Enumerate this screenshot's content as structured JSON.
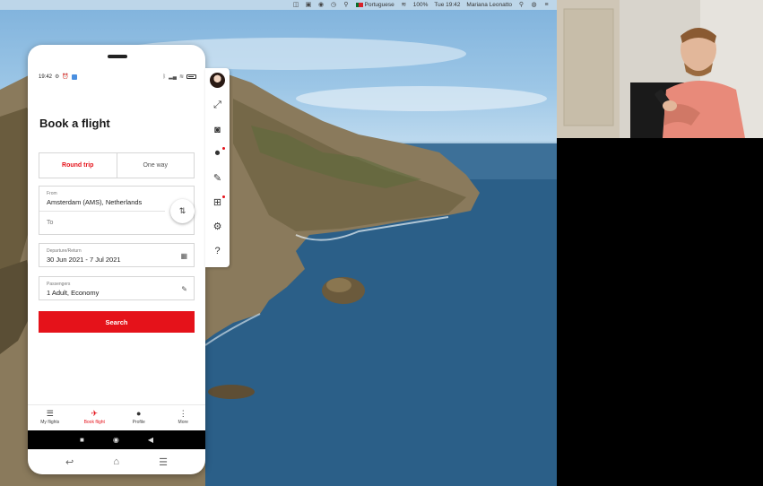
{
  "menubar": {
    "language": "Portuguese",
    "battery": "100%",
    "clock": "Tue 19:42",
    "user": "Mariana Leonatto"
  },
  "phone": {
    "status": {
      "time": "19:42"
    },
    "title": "Book a flight",
    "trip_type": {
      "options": [
        "Round trip",
        "One way"
      ],
      "selected": "Round trip"
    },
    "route": {
      "from_label": "From",
      "from_value": "Amsterdam (AMS), Netherlands",
      "to_placeholder": "To",
      "swap_icon": "swap-vertical-icon"
    },
    "dates": {
      "label": "Departure/Return",
      "value": "30 Jun 2021 - 7 Jul 2021",
      "icon": "calendar-icon"
    },
    "passengers": {
      "label": "Passengers",
      "value": "1 Adult, Economy",
      "icon": "pencil-icon"
    },
    "search_label": "Search",
    "bottom_nav": [
      {
        "label": "My flights",
        "icon": "list-icon"
      },
      {
        "label": "Book flight",
        "icon": "plane-icon",
        "active": true
      },
      {
        "label": "Profile",
        "icon": "person-icon"
      },
      {
        "label": "More",
        "icon": "more-vertical-icon"
      }
    ]
  },
  "emulator_toolbar": [
    "avatar",
    "fullscreen-icon",
    "screenshot-icon",
    "record-icon",
    "annotate-icon",
    "gift-icon",
    "settings-icon",
    "help-icon"
  ],
  "colors": {
    "accent": "#e5121a",
    "sea": "#2c5f86"
  }
}
